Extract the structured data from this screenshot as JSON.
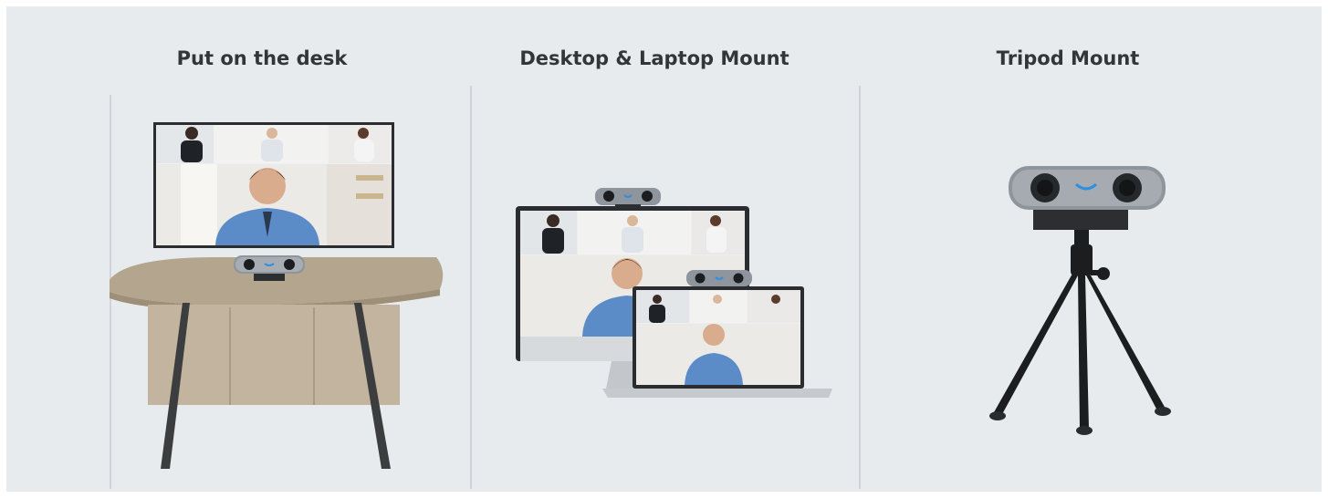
{
  "sections": [
    {
      "title": "Put on the desk"
    },
    {
      "title": "Desktop & Laptop Mount"
    },
    {
      "title": "Tripod Mount"
    }
  ],
  "colors": {
    "panel_bg": "#e8ebee",
    "title_text": "#333638",
    "divider": "#d0d4d8",
    "table_top": "#b3a58e",
    "cabinet": "#c2b49e",
    "camera_body": "#8f959c",
    "camera_accent": "#2d8fe0",
    "tripod": "#1c1d1f"
  },
  "icons": [
    "webcam-icon",
    "table-icon",
    "monitor-icon",
    "laptop-icon",
    "tripod-icon"
  ]
}
